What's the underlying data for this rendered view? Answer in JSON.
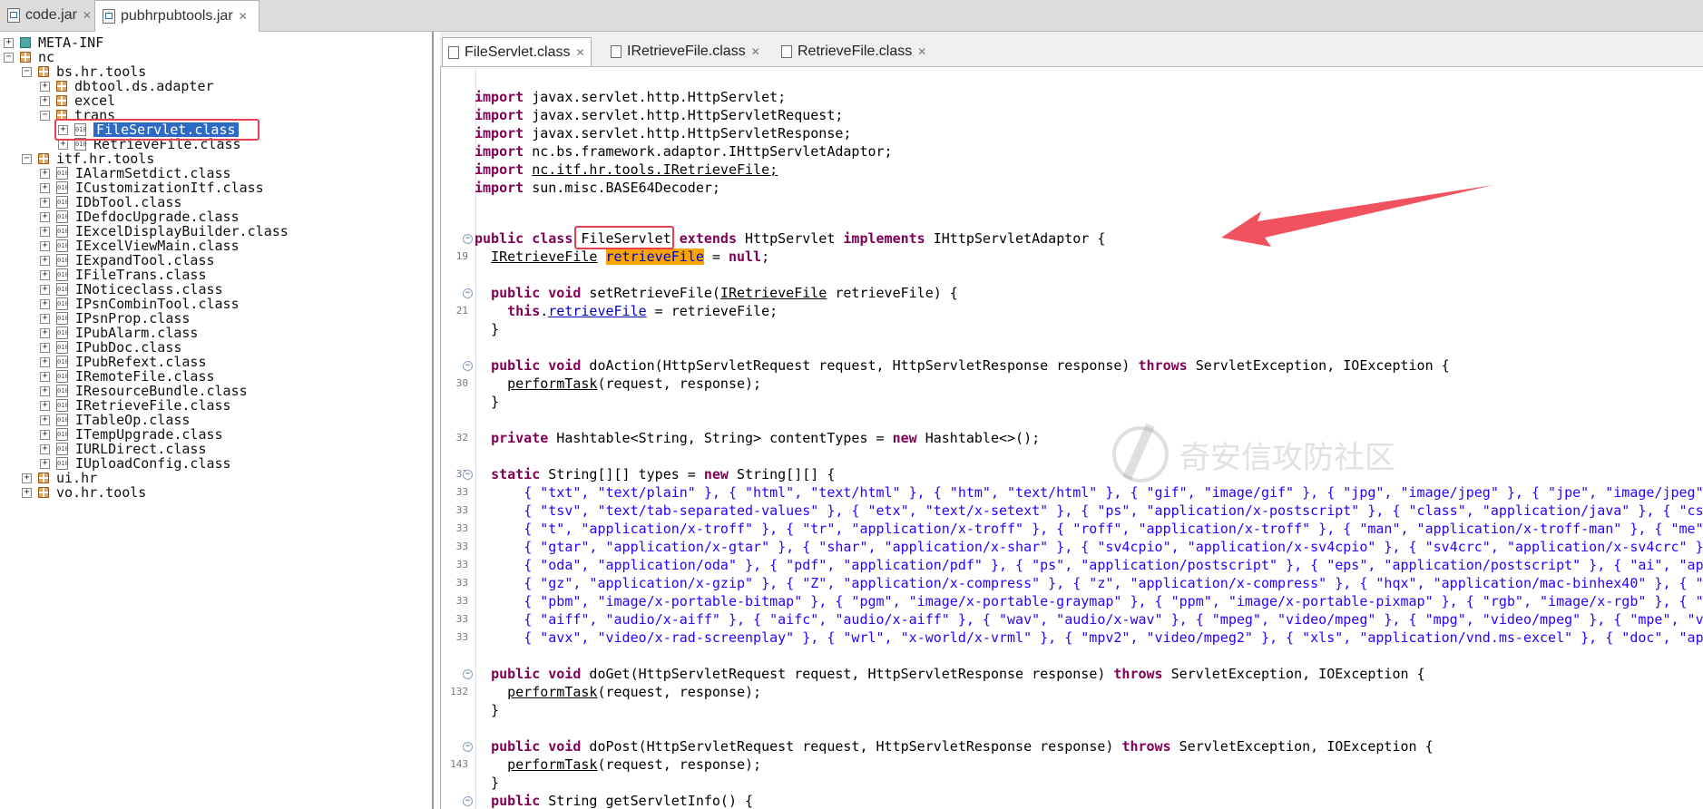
{
  "top_tabs": [
    {
      "label": "code.jar",
      "active": false
    },
    {
      "label": "pubhrpubtools.jar",
      "active": true
    }
  ],
  "tree": {
    "items": [
      {
        "label": "META-INF",
        "kind": "folder"
      },
      {
        "label": "nc",
        "kind": "package"
      },
      {
        "label": "bs.hr.tools",
        "kind": "package"
      },
      {
        "label": "dbtool.ds.adapter",
        "kind": "package"
      },
      {
        "label": "excel",
        "kind": "package"
      },
      {
        "label": "trans",
        "kind": "package"
      },
      {
        "label": "FileServlet.class",
        "kind": "class",
        "selected": true
      },
      {
        "label": "RetrieveFile.class",
        "kind": "class"
      },
      {
        "label": "itf.hr.tools",
        "kind": "package"
      },
      {
        "label": "IAlarmSetdict.class",
        "kind": "class"
      },
      {
        "label": "ICustomizationItf.class",
        "kind": "class"
      },
      {
        "label": "IDbTool.class",
        "kind": "class"
      },
      {
        "label": "IDefdocUpgrade.class",
        "kind": "class"
      },
      {
        "label": "IExcelDisplayBuilder.class",
        "kind": "class"
      },
      {
        "label": "IExcelViewMain.class",
        "kind": "class"
      },
      {
        "label": "IExpandTool.class",
        "kind": "class"
      },
      {
        "label": "IFileTrans.class",
        "kind": "class"
      },
      {
        "label": "INoticeclass.class",
        "kind": "class"
      },
      {
        "label": "IPsnCombinTool.class",
        "kind": "class"
      },
      {
        "label": "IPsnProp.class",
        "kind": "class"
      },
      {
        "label": "IPubAlarm.class",
        "kind": "class"
      },
      {
        "label": "IPubDoc.class",
        "kind": "class"
      },
      {
        "label": "IPubRefext.class",
        "kind": "class"
      },
      {
        "label": "IRemoteFile.class",
        "kind": "class"
      },
      {
        "label": "IResourceBundle.class",
        "kind": "class"
      },
      {
        "label": "IRetrieveFile.class",
        "kind": "class"
      },
      {
        "label": "ITableOp.class",
        "kind": "class"
      },
      {
        "label": "ITempUpgrade.class",
        "kind": "class"
      },
      {
        "label": "IURLDirect.class",
        "kind": "class"
      },
      {
        "label": "IUploadConfig.class",
        "kind": "class"
      },
      {
        "label": "ui.hr",
        "kind": "package"
      },
      {
        "label": "vo.hr.tools",
        "kind": "package"
      }
    ]
  },
  "editor_tabs": [
    {
      "label": "FileServlet.class",
      "active": true
    },
    {
      "label": "IRetrieveFile.class",
      "active": false
    },
    {
      "label": "RetrieveFile.class",
      "active": false
    }
  ],
  "code": {
    "imports": [
      "javax.servlet.http.HttpServlet;",
      "javax.servlet.http.HttpServletRequest;",
      "javax.servlet.http.HttpServletResponse;",
      "nc.bs.framework.adaptor.IHttpServletAdaptor;",
      "nc.itf.hr.tools.IRetrieveFile;",
      "sun.misc.BASE64Decoder;"
    ],
    "class_name": "FileServlet",
    "superclass": "HttpServlet",
    "interface": "IHttpServletAdaptor",
    "line_numbers": {
      "field": "19",
      "setter_body": "21",
      "doaction_body": "30",
      "hashtable": "32",
      "types": "33",
      "doget_body": "132",
      "dopost_body": "143"
    },
    "types_rows": [
      "{ \"txt\", \"text/plain\" }, { \"html\", \"text/html\" }, { \"htm\", \"text/html\" }, { \"gif\", \"image/gif\" }, { \"jpg\", \"image/jpeg\" }, { \"jpe\", \"image/jpeg\"",
      "{ \"tsv\", \"text/tab-separated-values\" }, { \"etx\", \"text/x-setext\" }, { \"ps\", \"application/x-postscript\" }, { \"class\", \"application/java\" }, { \"cs",
      "{ \"t\", \"application/x-troff\" }, { \"tr\", \"application/x-troff\" }, { \"roff\", \"application/x-troff\" }, { \"man\", \"application/x-troff-man\" }, { \"me\"",
      "{ \"gtar\", \"application/x-gtar\" }, { \"shar\", \"application/x-shar\" }, { \"sv4cpio\", \"application/x-sv4cpio\" }, { \"sv4crc\", \"application/x-sv4crc\" }",
      "{ \"oda\", \"application/oda\" }, { \"pdf\", \"application/pdf\" }, { \"ps\", \"application/postscript\" }, { \"eps\", \"application/postscript\" }, { \"ai\", \"ap",
      "{ \"gz\", \"application/x-gzip\" }, { \"Z\", \"application/x-compress\" }, { \"z\", \"application/x-compress\" }, { \"hqx\", \"application/mac-binhex40\" }, { \"",
      "{ \"pbm\", \"image/x-portable-bitmap\" }, { \"pgm\", \"image/x-portable-graymap\" }, { \"ppm\", \"image/x-portable-pixmap\" }, { \"rgb\", \"image/x-rgb\" }, { \"",
      "{ \"aiff\", \"audio/x-aiff\" }, { \"aifc\", \"audio/x-aiff\" }, { \"wav\", \"audio/x-wav\" }, { \"mpeg\", \"video/mpeg\" }, { \"mpg\", \"video/mpeg\" }, { \"mpe\", \"v",
      "{ \"avx\", \"video/x-rad-screenplay\" }, { \"wrl\", \"x-world/x-vrml\" }, { \"mpv2\", \"video/mpeg2\" }, { \"xls\", \"application/vnd.ms-excel\" }, { \"doc\", \"ap"
    ],
    "watermark": "奇安信攻防社区"
  },
  "colors": {
    "keyword": "#7f0055",
    "string": "#2a00ff",
    "highlight": "#f7a300",
    "selection": "#2d6ac4",
    "annotation": "#e84050"
  }
}
